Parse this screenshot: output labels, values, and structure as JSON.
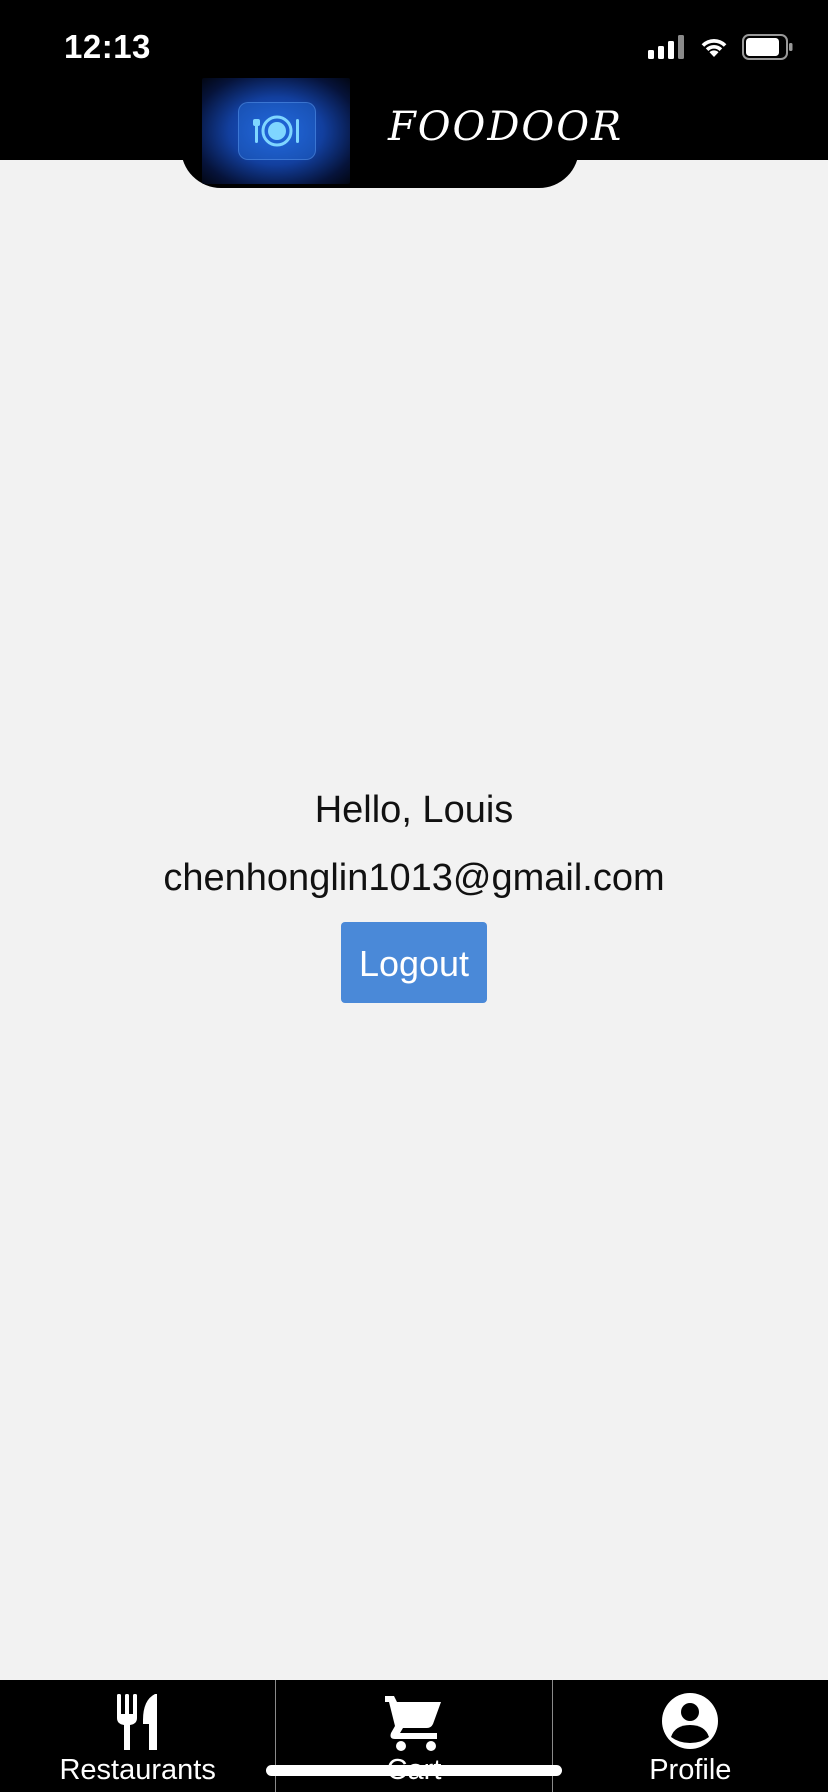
{
  "status_bar": {
    "time": "12:13",
    "icons": [
      "cellular-signal-icon",
      "wifi-icon",
      "battery-icon"
    ]
  },
  "header": {
    "brand": "FOODOOR",
    "logo_icon": "plate-cutlery-icon",
    "background_color": "#000000"
  },
  "profile": {
    "greeting": "Hello, Louis",
    "email": "chenhonglin1013@gmail.com",
    "logout_label": "Logout",
    "logout_color": "#4a89d8"
  },
  "tabbar": {
    "items": [
      {
        "label": "Restaurants",
        "icon": "fork-knife-icon"
      },
      {
        "label": "Cart",
        "icon": "cart-icon"
      },
      {
        "label": "Profile",
        "icon": "account-circle-icon"
      }
    ]
  },
  "colors": {
    "page_background": "#f2f2f2",
    "bars": "#000000"
  }
}
